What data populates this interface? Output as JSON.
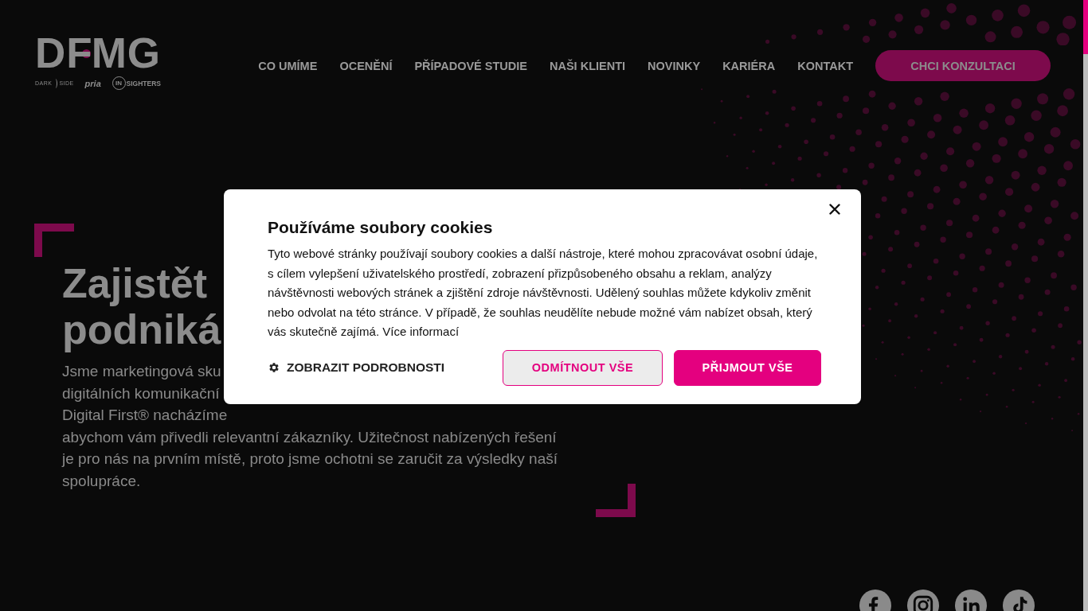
{
  "logo": {
    "wordmark_left": "D",
    "wordmark_mid": "F",
    "wordmark_right": "MG",
    "brands": [
      {
        "kind": "darkside",
        "label_a": "DARK",
        "label_b": "SIDE"
      },
      {
        "kind": "pria",
        "label_a": "pria"
      },
      {
        "kind": "insighters",
        "label_a": "IN",
        "label_b": "SIGHTERS"
      }
    ]
  },
  "nav": {
    "items": [
      "CO UMÍME",
      "OCENĚNÍ",
      "PŘÍPADOVÉ STUDIE",
      "NAŠI KLIENTI",
      "NOVINKY",
      "KARIÉRA",
      "KONTAKT"
    ],
    "cta": "CHCI KONZULTACI"
  },
  "hero": {
    "heading_lines": [
      "Zajistět",
      "podniká"
    ],
    "paragraph_lines": [
      "Jsme marketingová sku",
      "digitálních komunikační",
      "Digital First® nacházíme",
      "abychom vám přivedli relevantní zákazníky. Užitečnost nabízených řešení",
      "je pro nás na prvním místě, proto jsme ochotni se zaručit za výsledky naší",
      "spolupráce."
    ]
  },
  "cookie_dialog": {
    "title": "Používáme soubory cookies",
    "body": "Tyto webové stránky používají soubory cookies a další nástroje, které mohou zpracovávat osobní údaje, s cílem vylepšení uživatelského prostředí, zobrazení přizpůsobeného obsahu a reklam, analýzy návštěvnosti webových stránek a zjištění zdroje návštěvnosti. Udělený souhlas můžete kdykoliv změnit nebo odvolat na této stránce. V případě, že souhlas neudělíte nebude možné vám nabízet obsah, který vás skutečně zajímá.",
    "link": "Více informací",
    "details": "ZOBRAZIT PODROBNOSTI",
    "buttons": [
      {
        "label": "ODMÍTNOUT VŠE",
        "kind": "outline"
      },
      {
        "label": "PŘIJMOUT VŠE",
        "kind": "primary"
      }
    ]
  }
}
